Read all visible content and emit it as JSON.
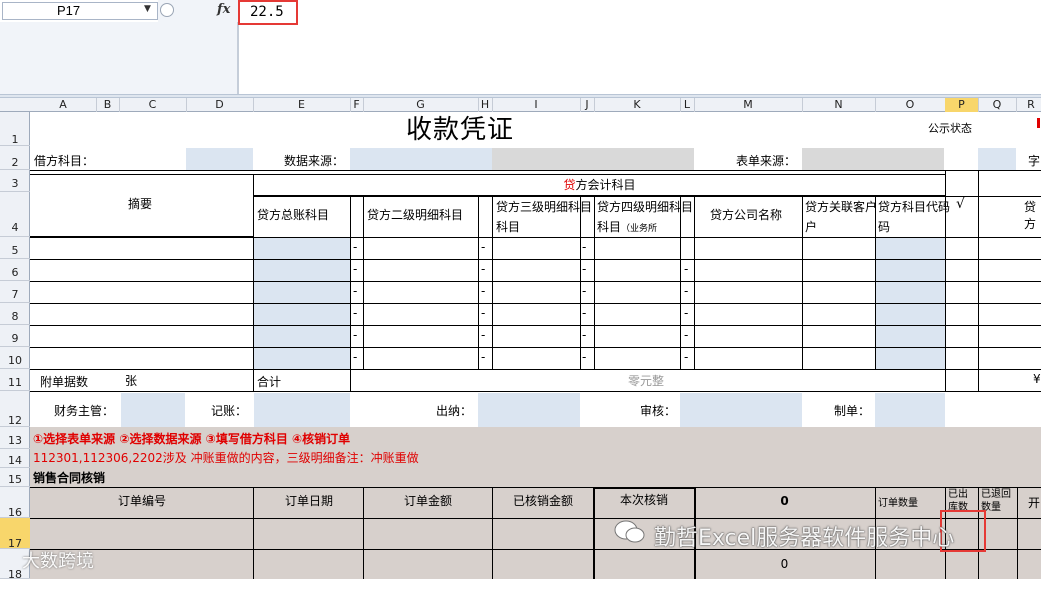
{
  "formula_bar": {
    "name_box": "P17",
    "fx_label": "fx",
    "value": "22.5"
  },
  "columns": [
    "A",
    "B",
    "C",
    "D",
    "E",
    "F",
    "G",
    "H",
    "I",
    "J",
    "K",
    "L",
    "M",
    "N",
    "O",
    "P",
    "Q",
    "R"
  ],
  "selected_column": "P",
  "rows": [
    "1",
    "2",
    "3",
    "4",
    "5",
    "6",
    "7",
    "8",
    "9",
    "10",
    "11",
    "12",
    "13",
    "14",
    "15",
    "16",
    "17",
    "18"
  ],
  "selected_row": "17",
  "sheet": {
    "title": "收款凭证",
    "status_label": "公示状态",
    "debit_subject_label": "借方科目：",
    "data_source_label": "数据来源：",
    "form_source_label": "表单来源：",
    "r2_extra": "字",
    "credit_accounting_subject_prefix": "贷",
    "credit_accounting_subject_rest": "方会计科目",
    "summary_label": "摘要",
    "credit_general_ledger": "贷方总账科目",
    "credit_level2": "贷方二级明细科目",
    "credit_level3": "贷方三级明细科目",
    "credit_level4": "贷方四级明细科目",
    "credit_level4_sub": "（业务所",
    "credit_company": "贷方公司名称",
    "credit_related_customer": "贷方关联客户",
    "credit_subject_code": "贷方科目代码",
    "check_mark": "√",
    "credit_extra": "贷方",
    "dash": "-",
    "attachments_label": "附单据数",
    "attachments_unit": "张",
    "total_label": "合计",
    "total_amount_words": "零元整",
    "yen": "¥",
    "finance_manager_label": "财务主管：",
    "bookkeeper_label": "记账：",
    "cashier_label": "出纳：",
    "auditor_label": "审核：",
    "preparer_label": "制单：",
    "instructions": "①选择表单来源  ②选择数据来源  ③填写借方科目  ④核销订单",
    "note": "112301,112306,2202涉及 冲账重做的内容，三级明细备注：冲账重做",
    "section_title": "销售合同核销",
    "order_no": "订单编号",
    "order_date": "订单日期",
    "order_amount": "订单金额",
    "written_off_amount": "已核销金额",
    "this_writeoff": "本次核销",
    "total_zero": "0",
    "order_qty": "订单数量",
    "shipped_qty": "已出库数",
    "returned_qty": "已退回数量",
    "open_col": "开",
    "r18_zero": "0"
  },
  "watermark": {
    "text": "勤哲Excel服务器软件服务中心",
    "brand": "大数跨境"
  }
}
